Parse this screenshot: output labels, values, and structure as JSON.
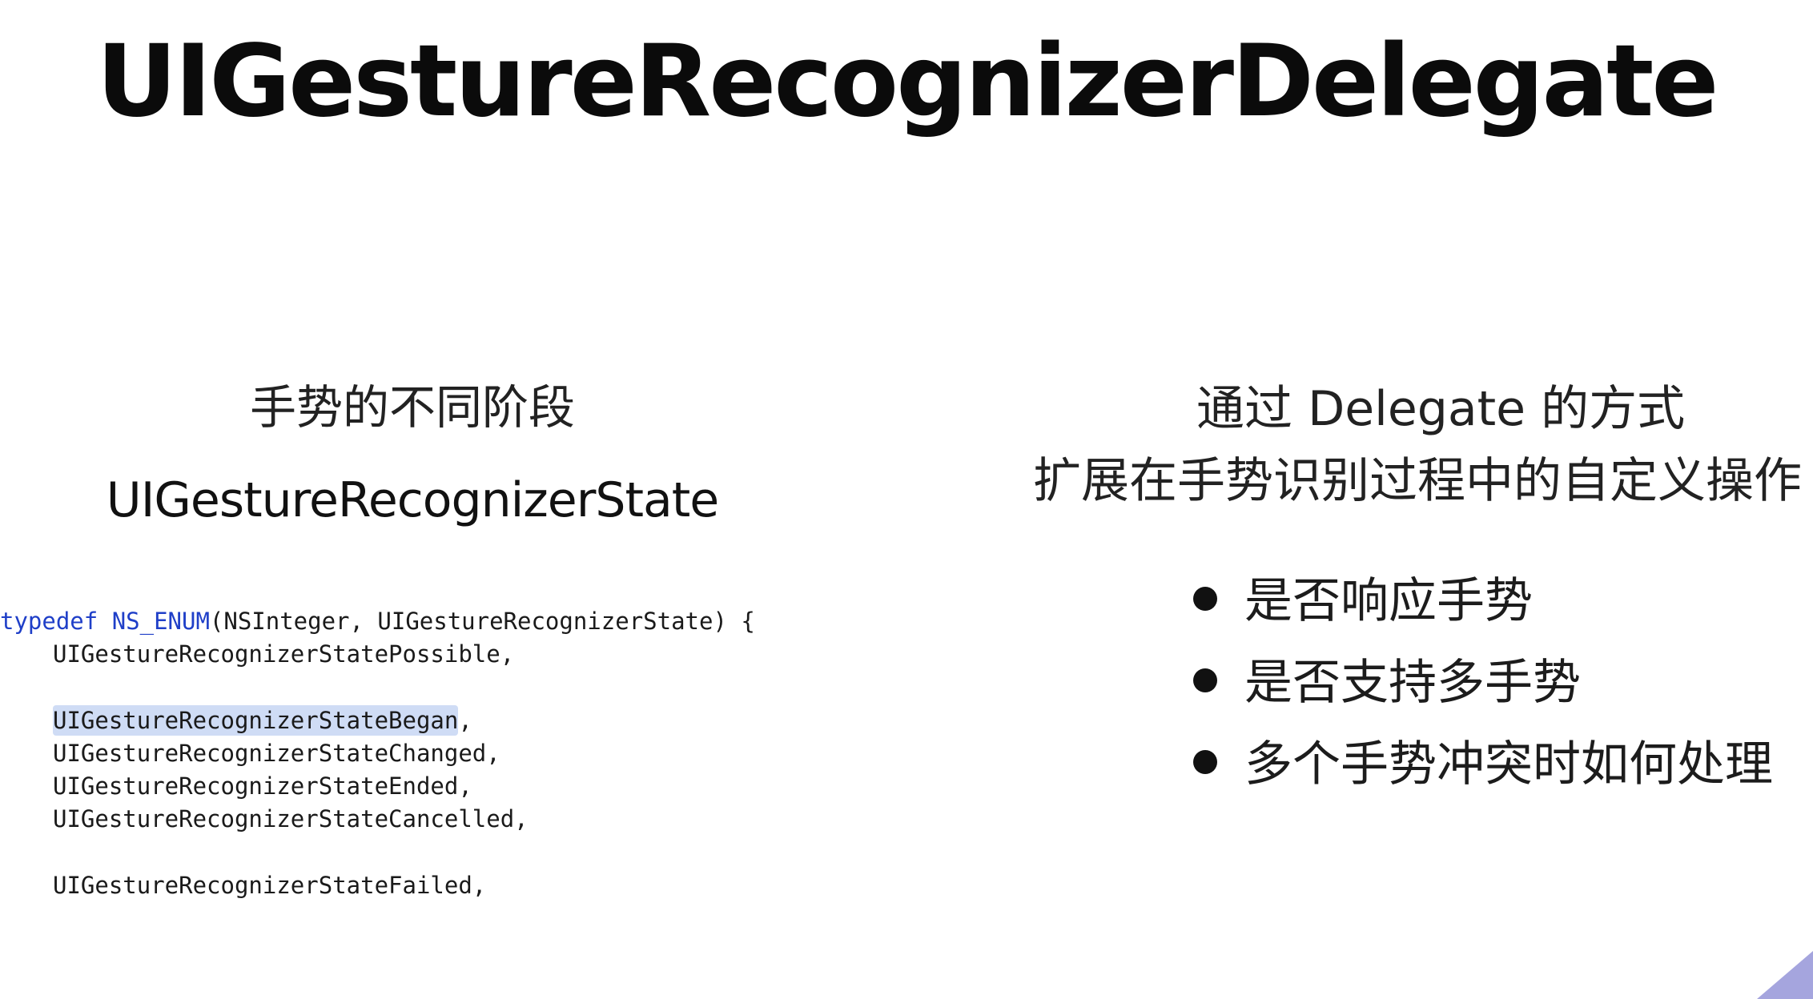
{
  "slide": {
    "title": "UIGestureRecognizerDelegate"
  },
  "left": {
    "heading": "手势的不同阶段",
    "subheading": "UIGestureRecognizerState",
    "code": {
      "line1_kw1": "typedef",
      "line1_kw2": "NS_ENUM",
      "line1_rest": "(NSInteger, UIGestureRecognizerState) {",
      "possible": "UIGestureRecognizerStatePossible,",
      "began": "UIGestureRecognizerStateBegan",
      "began_suffix": ",",
      "changed": "UIGestureRecognizerStateChanged,",
      "ended": "UIGestureRecognizerStateEnded,",
      "cancelled": "UIGestureRecognizerStateCancelled,",
      "failed": "UIGestureRecognizerStateFailed,"
    }
  },
  "right": {
    "heading_line1": "通过 Delegate 的方式",
    "heading_line2": "扩展在手势识别过程中的自定义操作",
    "bullets": [
      {
        "label": "是否响应手势"
      },
      {
        "label": "是否支持多手势"
      },
      {
        "label": "多个手势冲突时如何处理"
      }
    ]
  },
  "colors": {
    "keyword": "#1f3fc8",
    "highlight": "#cfdcf5",
    "corner_accent": "#8f8fd6"
  }
}
